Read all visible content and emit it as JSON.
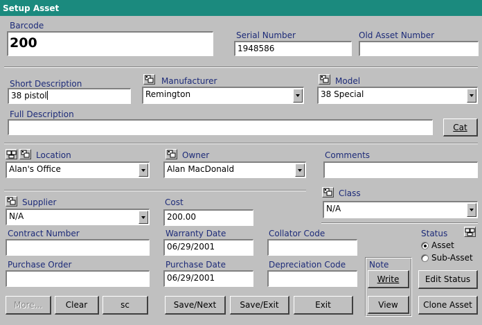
{
  "window": {
    "title": "Setup Asset"
  },
  "barcode": {
    "label": "Barcode",
    "value": "200"
  },
  "serial_number": {
    "label": "Serial Number",
    "value": "1948586"
  },
  "old_asset_number": {
    "label": "Old Asset Number",
    "value": ""
  },
  "short_description": {
    "label": "Short Description",
    "value": "38 pistol"
  },
  "manufacturer": {
    "label": "Manufacturer",
    "value": "Remington"
  },
  "model": {
    "label": "Model",
    "value": "38 Special"
  },
  "full_description": {
    "label": "Full Description",
    "value": "",
    "cat_button": "Cat"
  },
  "location": {
    "label": "Location",
    "value": "Alan's Office"
  },
  "owner": {
    "label": "Owner",
    "value": "Alan MacDonald"
  },
  "comments": {
    "label": "Comments",
    "value": ""
  },
  "supplier": {
    "label": "Supplier",
    "value": "N/A"
  },
  "cost": {
    "label": "Cost",
    "value": "200.00"
  },
  "class": {
    "label": "Class",
    "value": "N/A"
  },
  "contract_number": {
    "label": "Contract Number",
    "value": ""
  },
  "warranty_date": {
    "label": "Warranty Date",
    "value": "06/29/2001"
  },
  "collator_code": {
    "label": "Collator Code",
    "value": ""
  },
  "purchase_order": {
    "label": "Purchase Order",
    "value": ""
  },
  "purchase_date": {
    "label": "Purchase Date",
    "value": "06/29/2001"
  },
  "depreciation_code": {
    "label": "Depreciation Code",
    "value": ""
  },
  "status": {
    "label": "Status",
    "options": [
      "Asset",
      "Sub-Asset"
    ],
    "selected": "Asset"
  },
  "note": {
    "label": "Note",
    "write_button": "Write",
    "view_button": "View"
  },
  "buttons": {
    "more": "More...",
    "clear": "Clear",
    "sc": "sc",
    "save_next": "Save/Next",
    "save_exit": "Save/Exit",
    "exit": "Exit",
    "edit_status": "Edit Status",
    "clone_asset": "Clone Asset"
  },
  "colors": {
    "title_bar": "#1b8a7e",
    "label_text": "#1c2a78",
    "face": "#c0c0c0"
  }
}
